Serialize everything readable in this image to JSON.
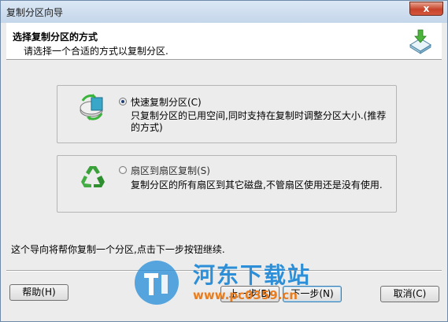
{
  "window": {
    "title": "复制分区向导",
    "close_label": "x"
  },
  "header": {
    "title": "选择复制分区的方式",
    "subtitle": "请选择一个合适的方式以复制分区."
  },
  "options": [
    {
      "label": "快速复制分区(C)",
      "description": "只复制分区的已用空间,同时支持在复制时调整分区大小.(推荐的方式)",
      "selected": true,
      "icon": "fast-copy-disk-icon"
    },
    {
      "label": "扇区到扇区复制(S)",
      "description": "复制分区的所有扇区到其它磁盘,不管扇区使用还是没有使用.",
      "selected": false,
      "icon": "recycle-icon"
    }
  ],
  "footer_text": "这个导向将帮你复制一个分区,点击下一步按钮继续.",
  "buttons": {
    "help": "帮助(H)",
    "back": "上一步(B)",
    "next": "下一步(N)",
    "cancel": "取消(C)"
  },
  "watermark": {
    "text": "河东下载站",
    "url": "www.pc0359.cn"
  },
  "colors": {
    "accent_blue": "#2c8fd8",
    "watermark_orange": "#e87c1e",
    "close_red": "#c7432a"
  }
}
